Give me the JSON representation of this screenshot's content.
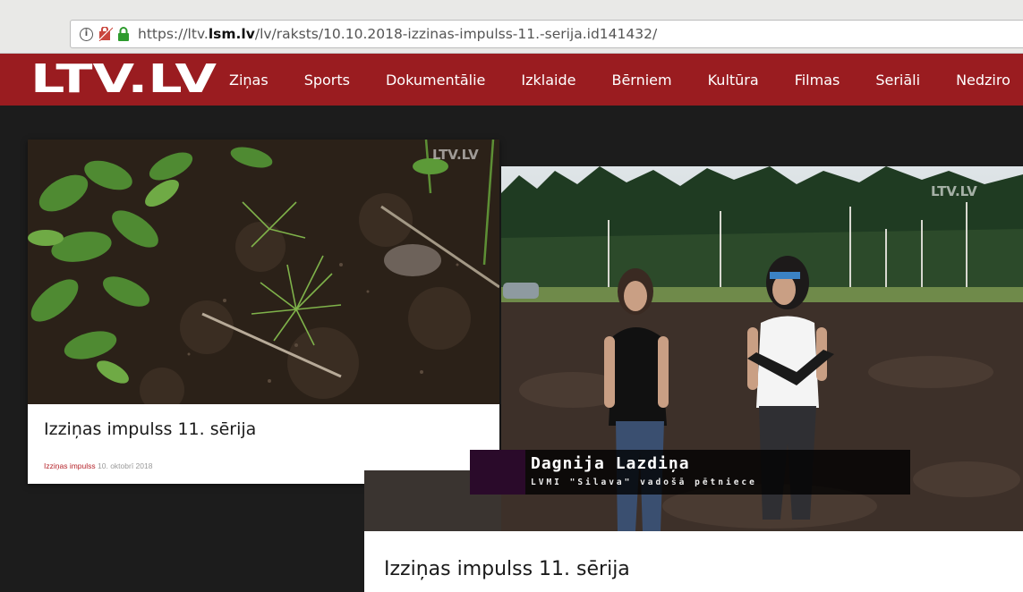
{
  "browser": {
    "url_prefix": "https://ltv.",
    "url_domain": "lsm.lv",
    "url_path": "/lv/raksts/10.10.2018-izzinas-impulss-11.-serija.id141432/",
    "info_icon": "info-icon",
    "mixed_content_icon": "mixed-content-icon",
    "lock_icon": "lock-icon"
  },
  "site": {
    "logo_text": "LTV.LV",
    "brand_color": "#9a1c20",
    "nav": [
      "Ziņas",
      "Sports",
      "Dokumentālie",
      "Izklaide",
      "Bērniem",
      "Kultūra",
      "Filmas",
      "Seriāli",
      "Nedziro"
    ]
  },
  "card1": {
    "title": "Izziņas impulss 11. sērija",
    "category": "Izziņas impulss",
    "date": "10. oktobrī 2018",
    "watermark": "LTV.LV"
  },
  "card2": {
    "title": "Izziņas impulss 11. sērija",
    "watermark": "LTV.LV",
    "caption_name": "Dagnija Lazdiņa",
    "caption_role": "LVMI \"Silava\" vadošā pētniece"
  }
}
